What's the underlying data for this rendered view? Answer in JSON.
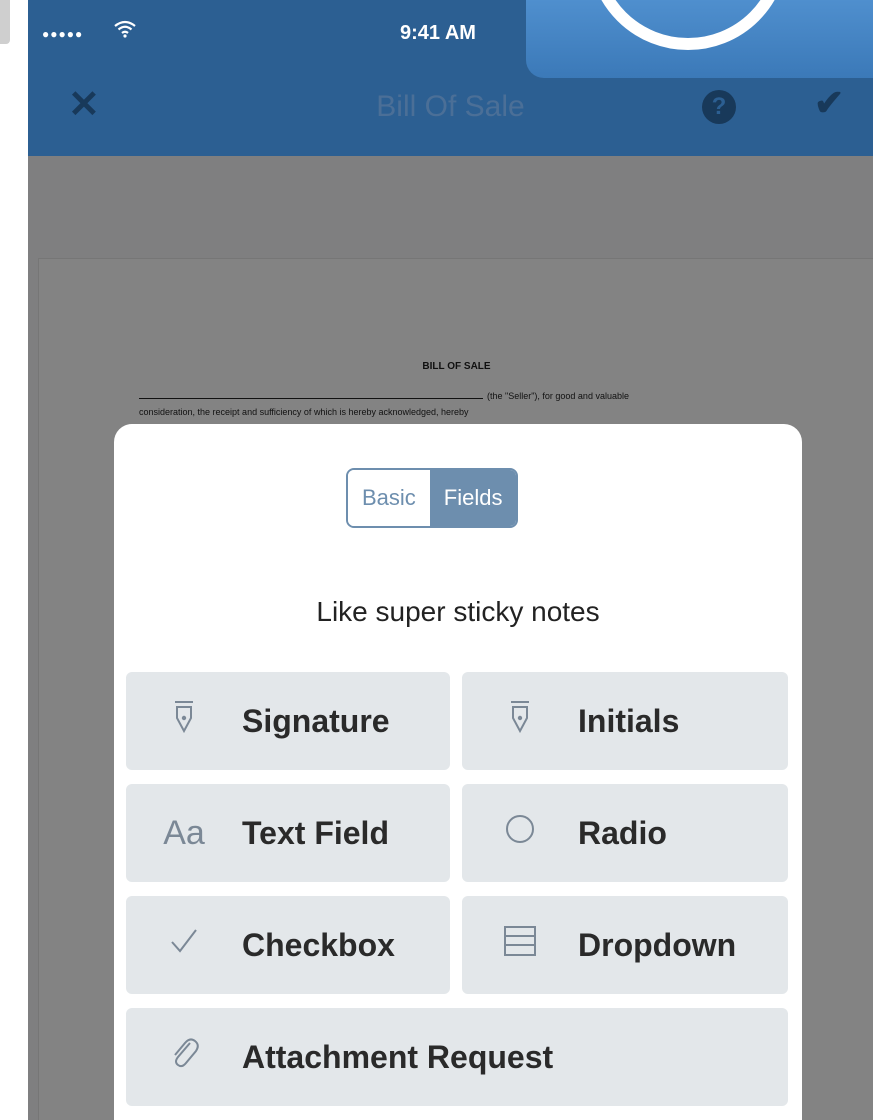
{
  "status_bar": {
    "signal": "●●●●●",
    "wifi": "wifi-icon",
    "time": "9:41 AM"
  },
  "nav": {
    "close_icon": "close-icon",
    "title": "Bill Of Sale",
    "help_glyph": "?",
    "done_icon": "checkmark-icon"
  },
  "document": {
    "heading": "BILL OF SALE",
    "line1": "(the \"Seller\"), for good and valuable",
    "line2": "consideration, the receipt and sufficiency of which is hereby acknowledged, hereby"
  },
  "sheet": {
    "tabs": [
      {
        "label": "Basic",
        "active": false
      },
      {
        "label": "Fields",
        "active": true
      }
    ],
    "tagline": "Like super sticky notes",
    "fields": [
      {
        "label": "Signature",
        "icon": "pen-nib-icon",
        "glyph": "⍗"
      },
      {
        "label": "Initials",
        "icon": "pen-nib-icon",
        "glyph": "⍗"
      },
      {
        "label": "Text Field",
        "icon": "text-aa-icon",
        "glyph": "Aa"
      },
      {
        "label": "Radio",
        "icon": "radio-circle-icon",
        "glyph": "○"
      },
      {
        "label": "Checkbox",
        "icon": "check-icon",
        "glyph": "✓"
      },
      {
        "label": "Dropdown",
        "icon": "dropdown-list-icon",
        "glyph": "☰"
      },
      {
        "label": "Attachment Request",
        "icon": "paperclip-icon",
        "glyph": "🖇"
      }
    ]
  },
  "colors": {
    "nav_bar": "#2c5f92",
    "dim_overlay": "#7f7f80",
    "segment_accent": "#6d8eae",
    "field_button": "#e3e7ea"
  }
}
